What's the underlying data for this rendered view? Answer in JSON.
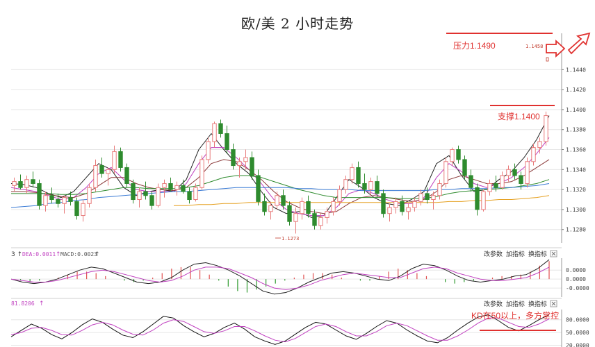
{
  "title": "欧/美 2 小时走势",
  "chart_data": [
    {
      "type": "candlestick",
      "yticks": [
        "1.1440",
        "1.1420",
        "1.1400",
        "1.1380",
        "1.1360",
        "1.1340",
        "1.1320",
        "1.1300",
        "1.1280"
      ],
      "ylim": [
        1.1268,
        1.1468
      ],
      "low_label": "1.1273",
      "high_label": "1.1458",
      "annotations": {
        "resistance": "压力1.1490",
        "support": "支撑1.1400"
      },
      "candles_ohlc": [
        [
          1.1324,
          1.1332,
          1.1318,
          1.1328
        ],
        [
          1.1328,
          1.1335,
          1.132,
          1.1322
        ],
        [
          1.1322,
          1.1334,
          1.1316,
          1.133
        ],
        [
          1.133,
          1.1338,
          1.1322,
          1.1326
        ],
        [
          1.1326,
          1.133,
          1.13,
          1.1304
        ],
        [
          1.1304,
          1.1318,
          1.1298,
          1.1314
        ],
        [
          1.1314,
          1.1322,
          1.1306,
          1.131
        ],
        [
          1.131,
          1.1316,
          1.1302,
          1.1306
        ],
        [
          1.1306,
          1.1314,
          1.1296,
          1.1312
        ],
        [
          1.1312,
          1.1318,
          1.1304,
          1.1308
        ],
        [
          1.1308,
          1.1312,
          1.129,
          1.1294
        ],
        [
          1.1294,
          1.131,
          1.1288,
          1.1306
        ],
        [
          1.1306,
          1.1326,
          1.1302,
          1.1322
        ],
        [
          1.1322,
          1.135,
          1.1318,
          1.1344
        ],
        [
          1.1344,
          1.1352,
          1.1332,
          1.1336
        ],
        [
          1.1336,
          1.1342,
          1.1324,
          1.134
        ],
        [
          1.134,
          1.1364,
          1.1336,
          1.1358
        ],
        [
          1.1358,
          1.1362,
          1.1338,
          1.1342
        ],
        [
          1.1342,
          1.1346,
          1.1322,
          1.1326
        ],
        [
          1.1326,
          1.133,
          1.1306,
          1.131
        ],
        [
          1.131,
          1.1322,
          1.1302,
          1.1318
        ],
        [
          1.1318,
          1.1328,
          1.131,
          1.1314
        ],
        [
          1.1314,
          1.1318,
          1.13,
          1.1304
        ],
        [
          1.1304,
          1.1326,
          1.1302,
          1.1322
        ],
        [
          1.1322,
          1.133,
          1.1312,
          1.1326
        ],
        [
          1.1326,
          1.1332,
          1.1318,
          1.132
        ],
        [
          1.132,
          1.1328,
          1.1314,
          1.1324
        ],
        [
          1.1324,
          1.133,
          1.1316,
          1.1318
        ],
        [
          1.1318,
          1.1322,
          1.1306,
          1.131
        ],
        [
          1.131,
          1.1326,
          1.1308,
          1.1322
        ],
        [
          1.1322,
          1.1354,
          1.132,
          1.135
        ],
        [
          1.135,
          1.1372,
          1.1346,
          1.1368
        ],
        [
          1.1368,
          1.1388,
          1.1362,
          1.1386
        ],
        [
          1.1386,
          1.139,
          1.1372,
          1.1376
        ],
        [
          1.1376,
          1.1384,
          1.1356,
          1.136
        ],
        [
          1.136,
          1.1366,
          1.134,
          1.1344
        ],
        [
          1.1344,
          1.1352,
          1.1332,
          1.1348
        ],
        [
          1.1348,
          1.136,
          1.134,
          1.1352
        ],
        [
          1.1352,
          1.1358,
          1.133,
          1.1334
        ],
        [
          1.1334,
          1.134,
          1.1304,
          1.1308
        ],
        [
          1.1308,
          1.1316,
          1.1294,
          1.1298
        ],
        [
          1.1298,
          1.1308,
          1.129,
          1.1304
        ],
        [
          1.1304,
          1.1318,
          1.13,
          1.1314
        ],
        [
          1.1314,
          1.132,
          1.13,
          1.1304
        ],
        [
          1.1304,
          1.1308,
          1.1284,
          1.1288
        ],
        [
          1.1288,
          1.1302,
          1.1276,
          1.1296
        ],
        [
          1.1296,
          1.1312,
          1.129,
          1.1308
        ],
        [
          1.1308,
          1.1314,
          1.1292,
          1.1296
        ],
        [
          1.1296,
          1.13,
          1.128,
          1.1284
        ],
        [
          1.1284,
          1.1296,
          1.128,
          1.1292
        ],
        [
          1.1292,
          1.1302,
          1.1286,
          1.1298
        ],
        [
          1.1298,
          1.1312,
          1.1294,
          1.1308
        ],
        [
          1.1308,
          1.1324,
          1.1304,
          1.132
        ],
        [
          1.132,
          1.1334,
          1.1316,
          1.133
        ],
        [
          1.133,
          1.1346,
          1.1326,
          1.1342
        ],
        [
          1.1342,
          1.1348,
          1.1322,
          1.1326
        ],
        [
          1.1326,
          1.1336,
          1.1316,
          1.132
        ],
        [
          1.132,
          1.1332,
          1.1314,
          1.1328
        ],
        [
          1.1328,
          1.1334,
          1.1312,
          1.1316
        ],
        [
          1.1316,
          1.132,
          1.1292,
          1.1296
        ],
        [
          1.1296,
          1.1306,
          1.1288,
          1.1302
        ],
        [
          1.1302,
          1.1312,
          1.1296,
          1.1308
        ],
        [
          1.1308,
          1.1314,
          1.1294,
          1.1298
        ],
        [
          1.1298,
          1.1306,
          1.129,
          1.1302
        ],
        [
          1.1302,
          1.1312,
          1.1298,
          1.1308
        ],
        [
          1.1308,
          1.132,
          1.1304,
          1.1316
        ],
        [
          1.1316,
          1.1322,
          1.1306,
          1.131
        ],
        [
          1.131,
          1.1318,
          1.13,
          1.1314
        ],
        [
          1.1314,
          1.133,
          1.131,
          1.1326
        ],
        [
          1.1326,
          1.1352,
          1.1322,
          1.1348
        ],
        [
          1.1348,
          1.1362,
          1.1344,
          1.136
        ],
        [
          1.136,
          1.1364,
          1.1346,
          1.135
        ],
        [
          1.135,
          1.1354,
          1.133,
          1.1334
        ],
        [
          1.1334,
          1.134,
          1.1318,
          1.1322
        ],
        [
          1.1322,
          1.1326,
          1.1294,
          1.13
        ],
        [
          1.13,
          1.132,
          1.1298,
          1.1318
        ],
        [
          1.1318,
          1.133,
          1.1314,
          1.1326
        ],
        [
          1.1326,
          1.1334,
          1.1318,
          1.1322
        ],
        [
          1.1322,
          1.1338,
          1.132,
          1.1334
        ],
        [
          1.1334,
          1.1344,
          1.1328,
          1.134
        ],
        [
          1.134,
          1.1346,
          1.133,
          1.1334
        ],
        [
          1.1334,
          1.1338,
          1.132,
          1.1326
        ],
        [
          1.1326,
          1.1352,
          1.1322,
          1.1348
        ],
        [
          1.1348,
          1.1366,
          1.1344,
          1.1362
        ],
        [
          1.1362,
          1.1372,
          1.1356,
          1.1368
        ],
        [
          1.1368,
          1.1398,
          1.1364,
          1.1394
        ]
      ],
      "moving_averages": [
        {
          "color": "#222222",
          "values": [
            1.1326,
            1.1325,
            1.1322,
            1.1316,
            1.1312,
            1.1318,
            1.1332,
            1.1346,
            1.134,
            1.1322,
            1.1314,
            1.1318,
            1.132,
            1.1318,
            1.133,
            1.136,
            1.1376,
            1.136,
            1.1346,
            1.1336,
            1.1318,
            1.1302,
            1.1296,
            1.1298,
            1.1292,
            1.1294,
            1.1312,
            1.133,
            1.1322,
            1.1312,
            1.1306,
            1.1304,
            1.131,
            1.1318,
            1.1346,
            1.1354,
            1.1334,
            1.1318,
            1.132,
            1.133,
            1.1338,
            1.1352,
            1.137,
            1.1394
          ]
        },
        {
          "color": "#c040c0",
          "values": [
            1.1322,
            1.132,
            1.1318,
            1.1314,
            1.131,
            1.1312,
            1.1322,
            1.1336,
            1.1342,
            1.133,
            1.132,
            1.1318,
            1.1318,
            1.1318,
            1.1326,
            1.1346,
            1.1362,
            1.1362,
            1.1352,
            1.134,
            1.1326,
            1.131,
            1.13,
            1.1296,
            1.1294,
            1.1294,
            1.1302,
            1.1316,
            1.132,
            1.1316,
            1.131,
            1.1306,
            1.1306,
            1.1312,
            1.1332,
            1.1346,
            1.1338,
            1.1326,
            1.1322,
            1.1326,
            1.1332,
            1.1342,
            1.1356,
            1.1372
          ]
        },
        {
          "color": "#8b3a3a",
          "values": [
            1.1318,
            1.1318,
            1.1317,
            1.1315,
            1.1313,
            1.1312,
            1.1316,
            1.1324,
            1.1332,
            1.1332,
            1.1326,
            1.1322,
            1.132,
            1.1319,
            1.1322,
            1.1332,
            1.1346,
            1.135,
            1.1348,
            1.134,
            1.133,
            1.1318,
            1.1308,
            1.1302,
            1.1298,
            1.1296,
            1.1298,
            1.1306,
            1.1312,
            1.1314,
            1.1312,
            1.131,
            1.1308,
            1.131,
            1.1318,
            1.133,
            1.1334,
            1.133,
            1.1326,
            1.1326,
            1.1328,
            1.1334,
            1.1342,
            1.135
          ]
        },
        {
          "color": "#2e8b2e",
          "values": [
            1.1316,
            1.1316,
            1.1316,
            1.1316,
            1.1315,
            1.1315,
            1.1316,
            1.1318,
            1.132,
            1.1322,
            1.1322,
            1.1321,
            1.1321,
            1.1321,
            1.1322,
            1.1324,
            1.1328,
            1.1332,
            1.1334,
            1.1334,
            1.1332,
            1.1328,
            1.1324,
            1.132,
            1.1317,
            1.1314,
            1.1312,
            1.1312,
            1.1312,
            1.1312,
            1.1312,
            1.1311,
            1.1311,
            1.1311,
            1.1313,
            1.1316,
            1.1318,
            1.1319,
            1.132,
            1.1321,
            1.1322,
            1.1324,
            1.1326,
            1.133
          ]
        },
        {
          "color": "#3a7bd5",
          "values": [
            1.1302,
            1.1303,
            1.1304,
            1.1306,
            1.1307,
            1.1309,
            1.131,
            1.1312,
            1.1313,
            1.1314,
            1.1315,
            1.1316,
            1.1317,
            1.1318,
            1.1318,
            1.1319,
            1.132,
            1.1321,
            1.1322,
            1.1322,
            1.1322,
            1.1322,
            1.1322,
            1.1321,
            1.1321,
            1.132,
            1.132,
            1.132,
            1.1319,
            1.1319,
            1.1319,
            1.1319,
            1.1319,
            1.1319,
            1.132,
            1.132,
            1.1321,
            1.1321,
            1.1321,
            1.1322,
            1.1322,
            1.1323,
            1.1324,
            1.1326
          ]
        },
        {
          "color": "#e5a020",
          "values": [
            null,
            null,
            null,
            null,
            null,
            null,
            null,
            null,
            null,
            null,
            null,
            null,
            null,
            1.1304,
            1.1304,
            1.1305,
            1.1305,
            1.1306,
            1.1306,
            1.1307,
            1.1307,
            1.1307,
            1.1307,
            1.1307,
            1.1307,
            1.1307,
            1.1307,
            1.1307,
            1.1307,
            1.1307,
            1.1307,
            1.1307,
            1.1307,
            1.1307,
            1.1307,
            1.1308,
            1.1308,
            1.1309,
            1.1309,
            1.131,
            1.131,
            1.1311,
            1.1312,
            1.1314
          ]
        }
      ]
    },
    {
      "type": "macd",
      "label_dea": "DEA:0.0011",
      "label_macd": "MACD:0.0023",
      "buttons": [
        "改参数",
        "加指标",
        "换指标"
      ],
      "yticks": [
        "0.0000",
        "0.0000",
        "-0.0000"
      ],
      "ylim": [
        -0.0012,
        0.0014
      ],
      "histogram": [
        0.0,
        -0.0001,
        -0.0002,
        -0.0001,
        0.0,
        0.0001,
        0.0003,
        0.0005,
        0.0005,
        0.0004,
        0.0002,
        0.0,
        -0.0001,
        -0.0002,
        -0.0001,
        0.0001,
        0.0004,
        0.0007,
        0.0008,
        0.0008,
        0.0006,
        0.0003,
        -0.0001,
        -0.0005,
        -0.0008,
        -0.0009,
        -0.0007,
        -0.0005,
        -0.0003,
        -0.0001,
        0.0001,
        0.0003,
        0.0004,
        0.0004,
        0.0003,
        0.0001,
        0.0,
        -0.0001,
        -0.0001,
        0.0002,
        0.0005,
        0.0007,
        0.0006,
        0.0004,
        0.0002,
        0.0,
        -0.0002,
        -0.0003,
        -0.0002,
        -0.0001,
        0.0,
        0.0001,
        0.0002,
        0.0002,
        0.0003,
        0.0005,
        0.0009,
        0.0012
      ],
      "dif": [
        0.0,
        -0.0002,
        -0.0003,
        -0.0002,
        0.0,
        0.0003,
        0.0006,
        0.0008,
        0.0007,
        0.0004,
        0.0001,
        -0.0002,
        -0.0003,
        -0.0002,
        0.0001,
        0.0006,
        0.001,
        0.0011,
        0.0009,
        0.0006,
        0.0002,
        -0.0003,
        -0.0008,
        -0.001,
        -0.0009,
        -0.0006,
        -0.0002,
        0.0001,
        0.0004,
        0.0005,
        0.0004,
        0.0002,
        0.0,
        -0.0001,
        0.0002,
        0.0007,
        0.001,
        0.0009,
        0.0006,
        0.0002,
        -0.0001,
        -0.0002,
        -0.0001,
        0.0,
        0.0002,
        0.0003,
        0.0007,
        0.0013
      ],
      "dea": [
        0.0,
        -0.0001,
        -0.0002,
        -0.0002,
        -0.0001,
        0.0001,
        0.0003,
        0.0005,
        0.0006,
        0.0005,
        0.0003,
        0.0001,
        -0.0001,
        -0.0002,
        -0.0001,
        0.0002,
        0.0006,
        0.0008,
        0.0008,
        0.0007,
        0.0004,
        0.0001,
        -0.0003,
        -0.0006,
        -0.0007,
        -0.0006,
        -0.0004,
        -0.0001,
        0.0001,
        0.0003,
        0.0004,
        0.0003,
        0.0002,
        0.0001,
        0.0001,
        0.0004,
        0.0007,
        0.0008,
        0.0007,
        0.0004,
        0.0002,
        0.0,
        -0.0001,
        -0.0001,
        0.0,
        0.0001,
        0.0004,
        0.0008
      ]
    },
    {
      "type": "kd",
      "label": "81.8206",
      "buttons": [
        "改参数",
        "加指标",
        "换指标"
      ],
      "yticks": [
        "80.0000",
        "50.0000",
        "20.0000"
      ],
      "ylim": [
        16,
        104
      ],
      "annotation": "KD在50以上，多方掌控",
      "k": [
        40,
        55,
        70,
        60,
        45,
        35,
        50,
        68,
        82,
        74,
        58,
        44,
        38,
        52,
        70,
        88,
        84,
        66,
        52,
        40,
        48,
        62,
        72,
        58,
        40,
        30,
        22,
        30,
        46,
        62,
        74,
        70,
        56,
        42,
        34,
        48,
        64,
        78,
        72,
        56,
        42,
        30,
        26,
        38,
        56,
        72,
        86,
        92,
        78,
        62,
        54,
        66,
        80,
        92
      ],
      "d": [
        45,
        50,
        60,
        62,
        55,
        45,
        44,
        55,
        68,
        74,
        68,
        56,
        46,
        44,
        56,
        72,
        80,
        76,
        64,
        52,
        48,
        54,
        64,
        64,
        54,
        42,
        32,
        28,
        36,
        50,
        64,
        70,
        64,
        52,
        42,
        42,
        52,
        66,
        72,
        66,
        54,
        42,
        32,
        32,
        42,
        56,
        72,
        84,
        84,
        74,
        64,
        62,
        70,
        82
      ]
    }
  ]
}
